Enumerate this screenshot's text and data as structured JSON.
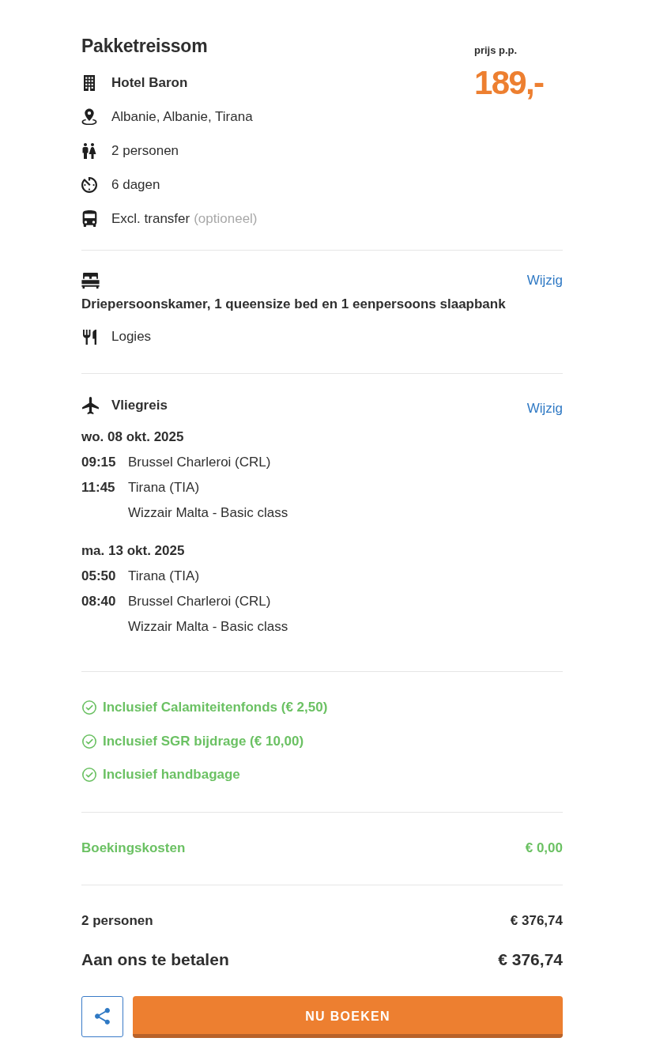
{
  "header": {
    "title": "Pakketreissom",
    "price_label": "prijs p.p.",
    "price": "189,-"
  },
  "details": [
    {
      "kind": "hotel",
      "text": "Hotel Baron"
    },
    {
      "kind": "location",
      "text": "Albanie, Albanie, Tirana"
    },
    {
      "kind": "persons",
      "text": "2 personen"
    },
    {
      "kind": "duration",
      "text": "6 dagen"
    },
    {
      "kind": "transfer",
      "text": "Excl. transfer",
      "note": "(optioneel)"
    }
  ],
  "accommodation": {
    "edit_link": "Wijzig",
    "room": "Driepersoonskamer, 1 queensize bed en 1 eenpersoons slaapbank",
    "meal": "Logies"
  },
  "flight": {
    "title": "Vliegreis",
    "edit_link": "Wijzig",
    "legs": [
      {
        "date": "wo. 08 okt. 2025",
        "segments": [
          {
            "time": "09:15",
            "place": "Brussel Charleroi (CRL)"
          },
          {
            "time": "11:45",
            "place": "Tirana (TIA)"
          }
        ],
        "carrier": "Wizzair Malta - Basic class"
      },
      {
        "date": "ma. 13 okt. 2025",
        "segments": [
          {
            "time": "05:50",
            "place": "Tirana (TIA)"
          },
          {
            "time": "08:40",
            "place": "Brussel Charleroi (CRL)"
          }
        ],
        "carrier": "Wizzair Malta - Basic class"
      }
    ]
  },
  "inclusions": [
    "Inclusief Calamiteitenfonds (€ 2,50)",
    "Inclusief SGR bijdrage (€ 10,00)",
    "Inclusief handbagage"
  ],
  "booking_fee": {
    "label": "Boekingskosten",
    "amount": "€ 0,00"
  },
  "totals": [
    {
      "kind": "subtotal",
      "label": "2 personen",
      "amount": "€ 376,74"
    },
    {
      "kind": "total",
      "label": "Aan ons te betalen",
      "amount": "€ 376,74"
    }
  ],
  "actions": {
    "book_button": "NU BOEKEN"
  }
}
